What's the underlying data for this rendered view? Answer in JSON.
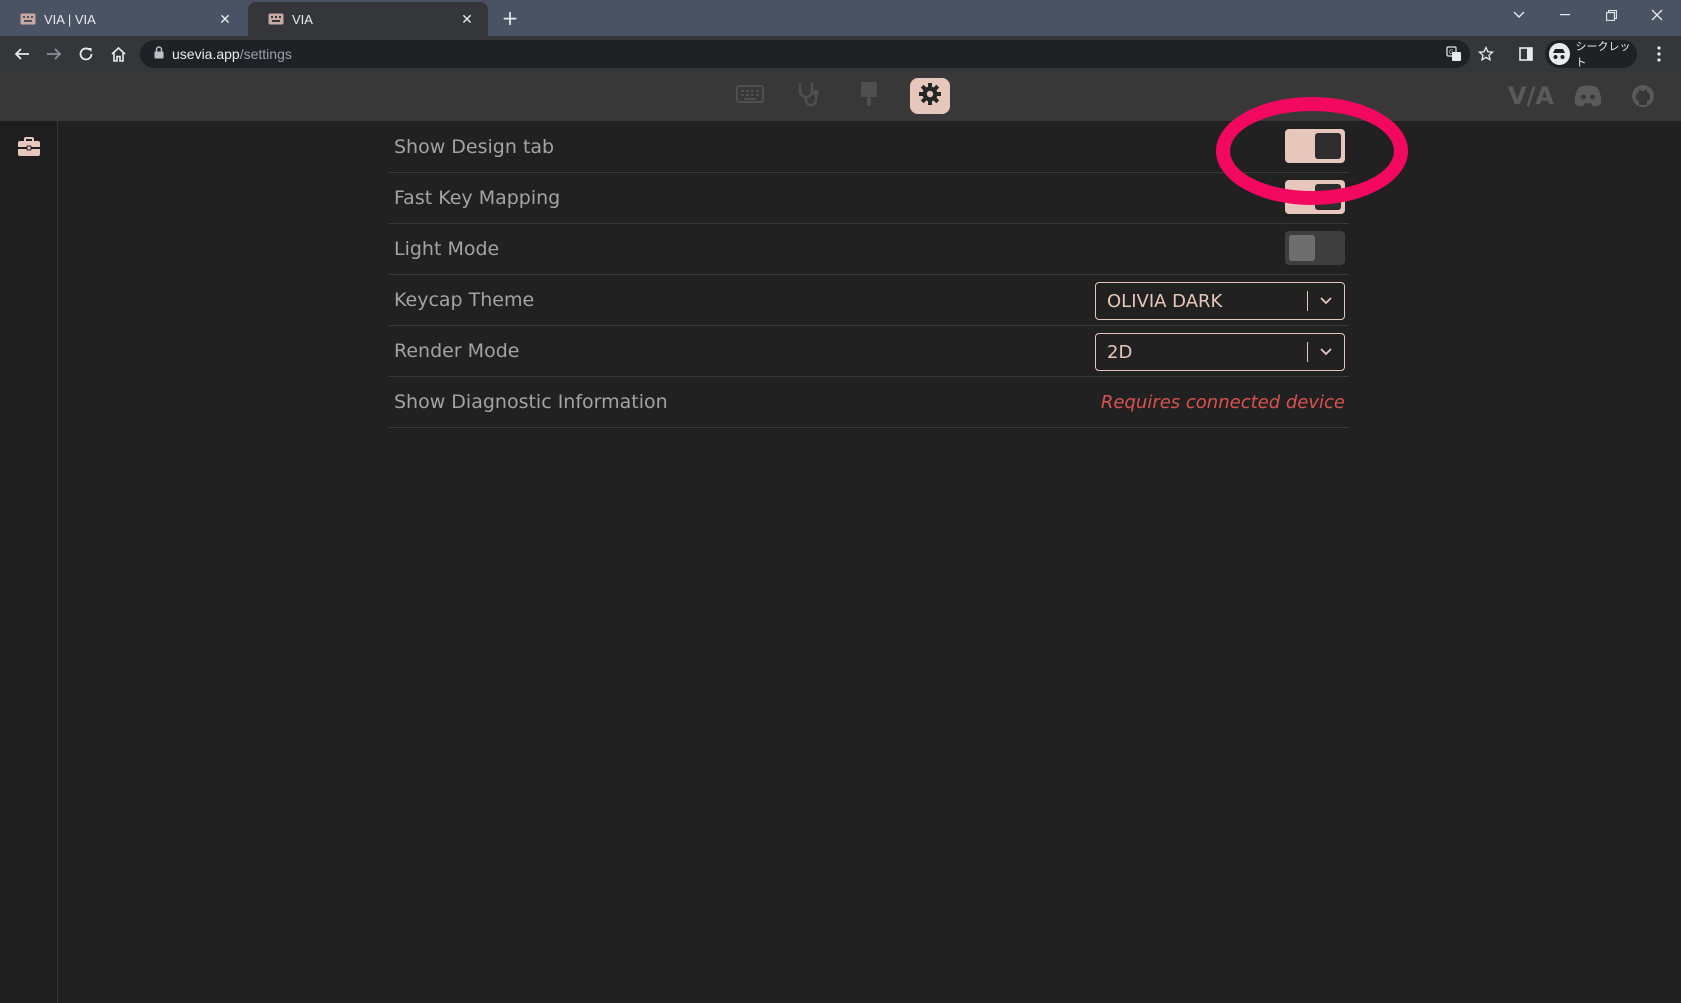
{
  "browser": {
    "tabs": [
      {
        "title": "VIA | VIA",
        "active": false
      },
      {
        "title": "VIA",
        "active": true
      }
    ],
    "url_host": "usevia.app",
    "url_path": "/settings",
    "incognito_label": "シークレット",
    "new_tab_label": "+"
  },
  "app": {
    "nav": [
      {
        "name": "keyboard-icon",
        "active": false
      },
      {
        "name": "stethoscope-icon",
        "active": false
      },
      {
        "name": "paintbrush-icon",
        "active": false
      },
      {
        "name": "gear-icon",
        "active": true
      }
    ],
    "brand_via": "V/A",
    "accent_color": "#e7c7bb",
    "error_color": "#d9534f"
  },
  "settings": {
    "show_design_tab": {
      "label": "Show Design tab",
      "enabled": true
    },
    "fast_key_mapping": {
      "label": "Fast Key Mapping",
      "enabled": true
    },
    "light_mode": {
      "label": "Light Mode",
      "enabled": false
    },
    "keycap_theme": {
      "label": "Keycap Theme",
      "value": "OLIVIA DARK"
    },
    "render_mode": {
      "label": "Render Mode",
      "value": "2D"
    },
    "diagnostic": {
      "label": "Show Diagnostic Information",
      "status": "Requires connected device"
    }
  },
  "annotation": {
    "shape": "circle",
    "color": "#f2085f",
    "target": "show-design-tab-toggle"
  }
}
